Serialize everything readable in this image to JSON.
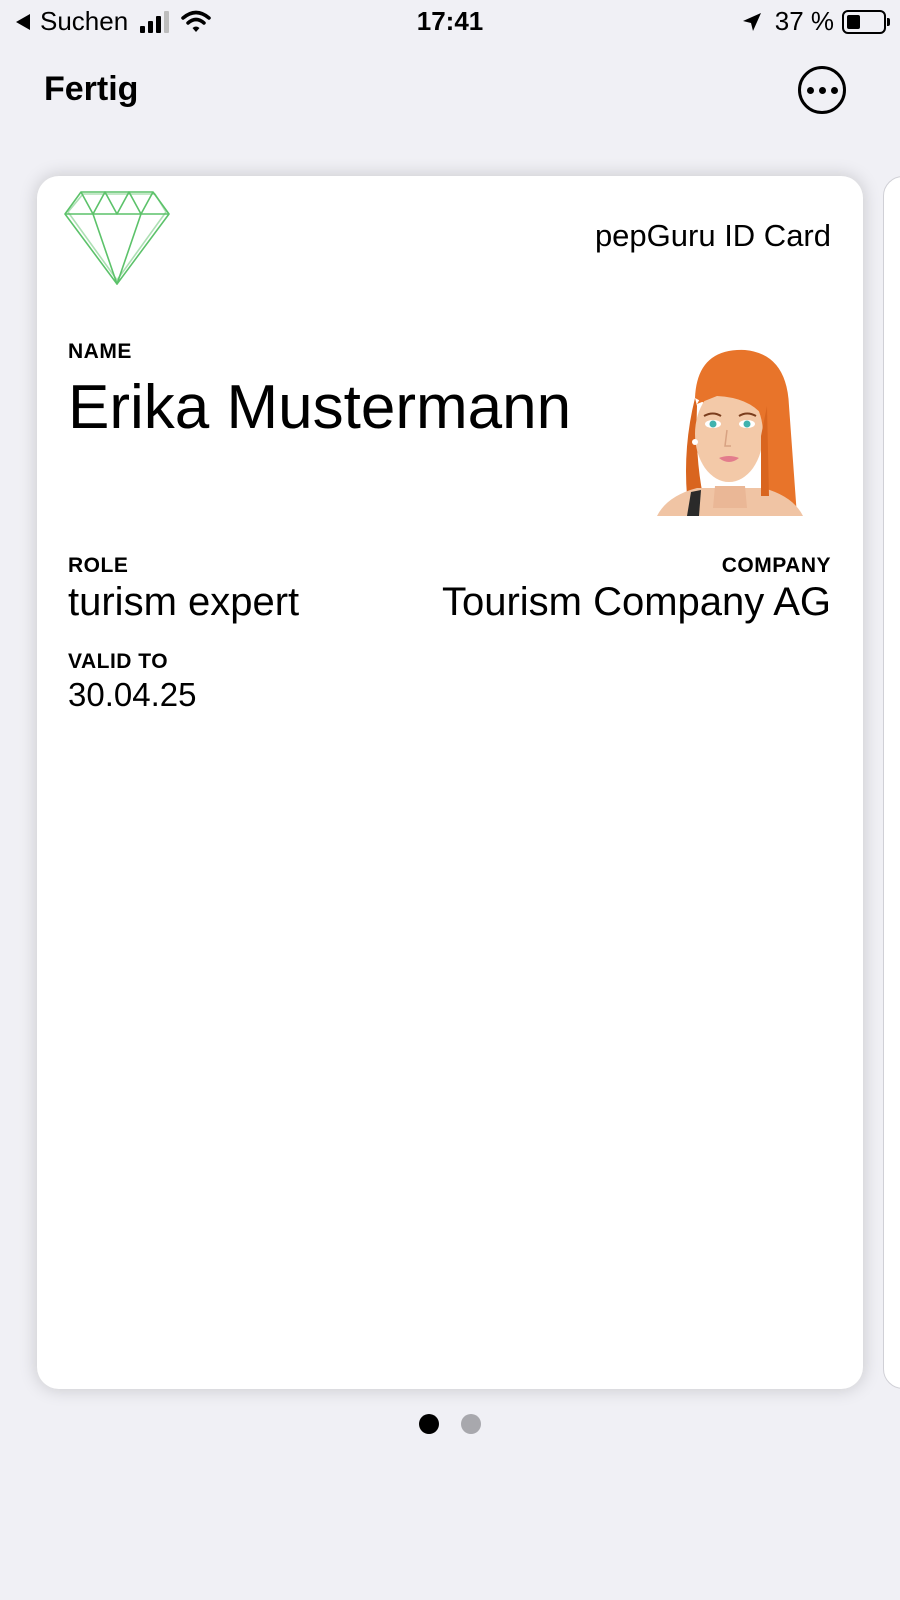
{
  "status_bar": {
    "back_label": "Suchen",
    "time": "17:41",
    "battery_text": "37 %",
    "battery_level": 0.37,
    "signal_bars_active": 3,
    "icons": [
      "back-triangle-icon",
      "signal-icon",
      "wifi-icon",
      "location-arrow-icon",
      "battery-icon"
    ]
  },
  "nav": {
    "done_label": "Fertig",
    "more_icon": "ellipsis-circle-icon"
  },
  "card": {
    "title": "pepGuru ID Card",
    "logo_icon": "diamond-icon",
    "logo_color": "#5cc26a",
    "name": {
      "label": "NAME",
      "value": "Erika Mustermann"
    },
    "photo": "avatar-woman-red-hair",
    "role": {
      "label": "ROLE",
      "value": "turism expert"
    },
    "company": {
      "label": "COMPANY",
      "value": "Tourism Company AG"
    },
    "valid_to": {
      "label": "VALID TO",
      "value": "30.04.25"
    }
  },
  "pagination": {
    "total": 2,
    "active_index": 0
  }
}
